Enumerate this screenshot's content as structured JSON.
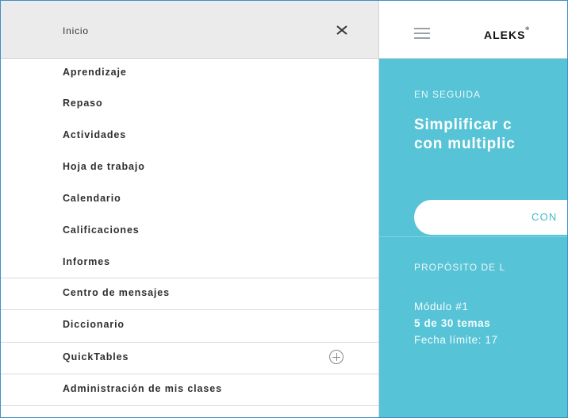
{
  "sidebar": {
    "header_label": "Inicio",
    "items": [
      {
        "label": "Aprendizaje"
      },
      {
        "label": "Repaso"
      },
      {
        "label": "Actividades"
      },
      {
        "label": "Hoja de trabajo"
      },
      {
        "label": "Calendario"
      },
      {
        "label": "Calificaciones"
      },
      {
        "label": "Informes"
      },
      {
        "label": "Centro de mensajes"
      },
      {
        "label": "Diccionario"
      },
      {
        "label": "QuickTables"
      },
      {
        "label": "Administración de mis clases"
      }
    ],
    "icons": {
      "close": "close-icon",
      "expand": "plus-circle-icon"
    }
  },
  "topbar": {
    "brand": "ALEKS",
    "brand_mark": "®",
    "menu_icon": "hamburger-menu-icon"
  },
  "panel": {
    "next_label": "EN SEGUIDA",
    "title_line1": "Simplificar c",
    "title_line2": "con multiplic",
    "cta_label": "CON",
    "goal_label": "PROPÓSITO DE L",
    "module": "Módulo #1",
    "progress": "5 de 30 temas",
    "due": "Fecha límite: 17"
  },
  "colors": {
    "accent": "#57c3d6",
    "frame_border": "#3f8fc7",
    "header_bg": "#ebebeb"
  }
}
